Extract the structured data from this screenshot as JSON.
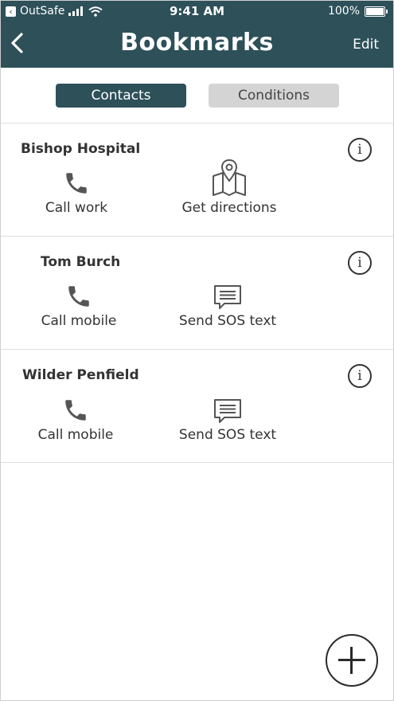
{
  "status_bar": {
    "carrier": "OutSafe",
    "time": "9:41 AM",
    "battery": "100%"
  },
  "nav": {
    "title": "Bookmarks",
    "edit_label": "Edit"
  },
  "tabs": [
    {
      "label": "Contacts",
      "active": true
    },
    {
      "label": "Conditions",
      "active": false
    }
  ],
  "contacts": [
    {
      "name": "Bishop Hospital",
      "actions": [
        {
          "label": "Call work",
          "icon": "phone-icon"
        },
        {
          "label": "Get directions",
          "icon": "map-pin-icon"
        }
      ]
    },
    {
      "name": "Tom Burch",
      "actions": [
        {
          "label": "Call mobile",
          "icon": "phone-icon"
        },
        {
          "label": "Send SOS text",
          "icon": "message-icon"
        }
      ]
    },
    {
      "name": "Wilder Penfield",
      "actions": [
        {
          "label": "Call mobile",
          "icon": "phone-icon"
        },
        {
          "label": "Send SOS text",
          "icon": "message-icon"
        }
      ]
    }
  ],
  "colors": {
    "header": "#2d5059",
    "tab_inactive": "#d4d4d4",
    "text": "#333333"
  }
}
